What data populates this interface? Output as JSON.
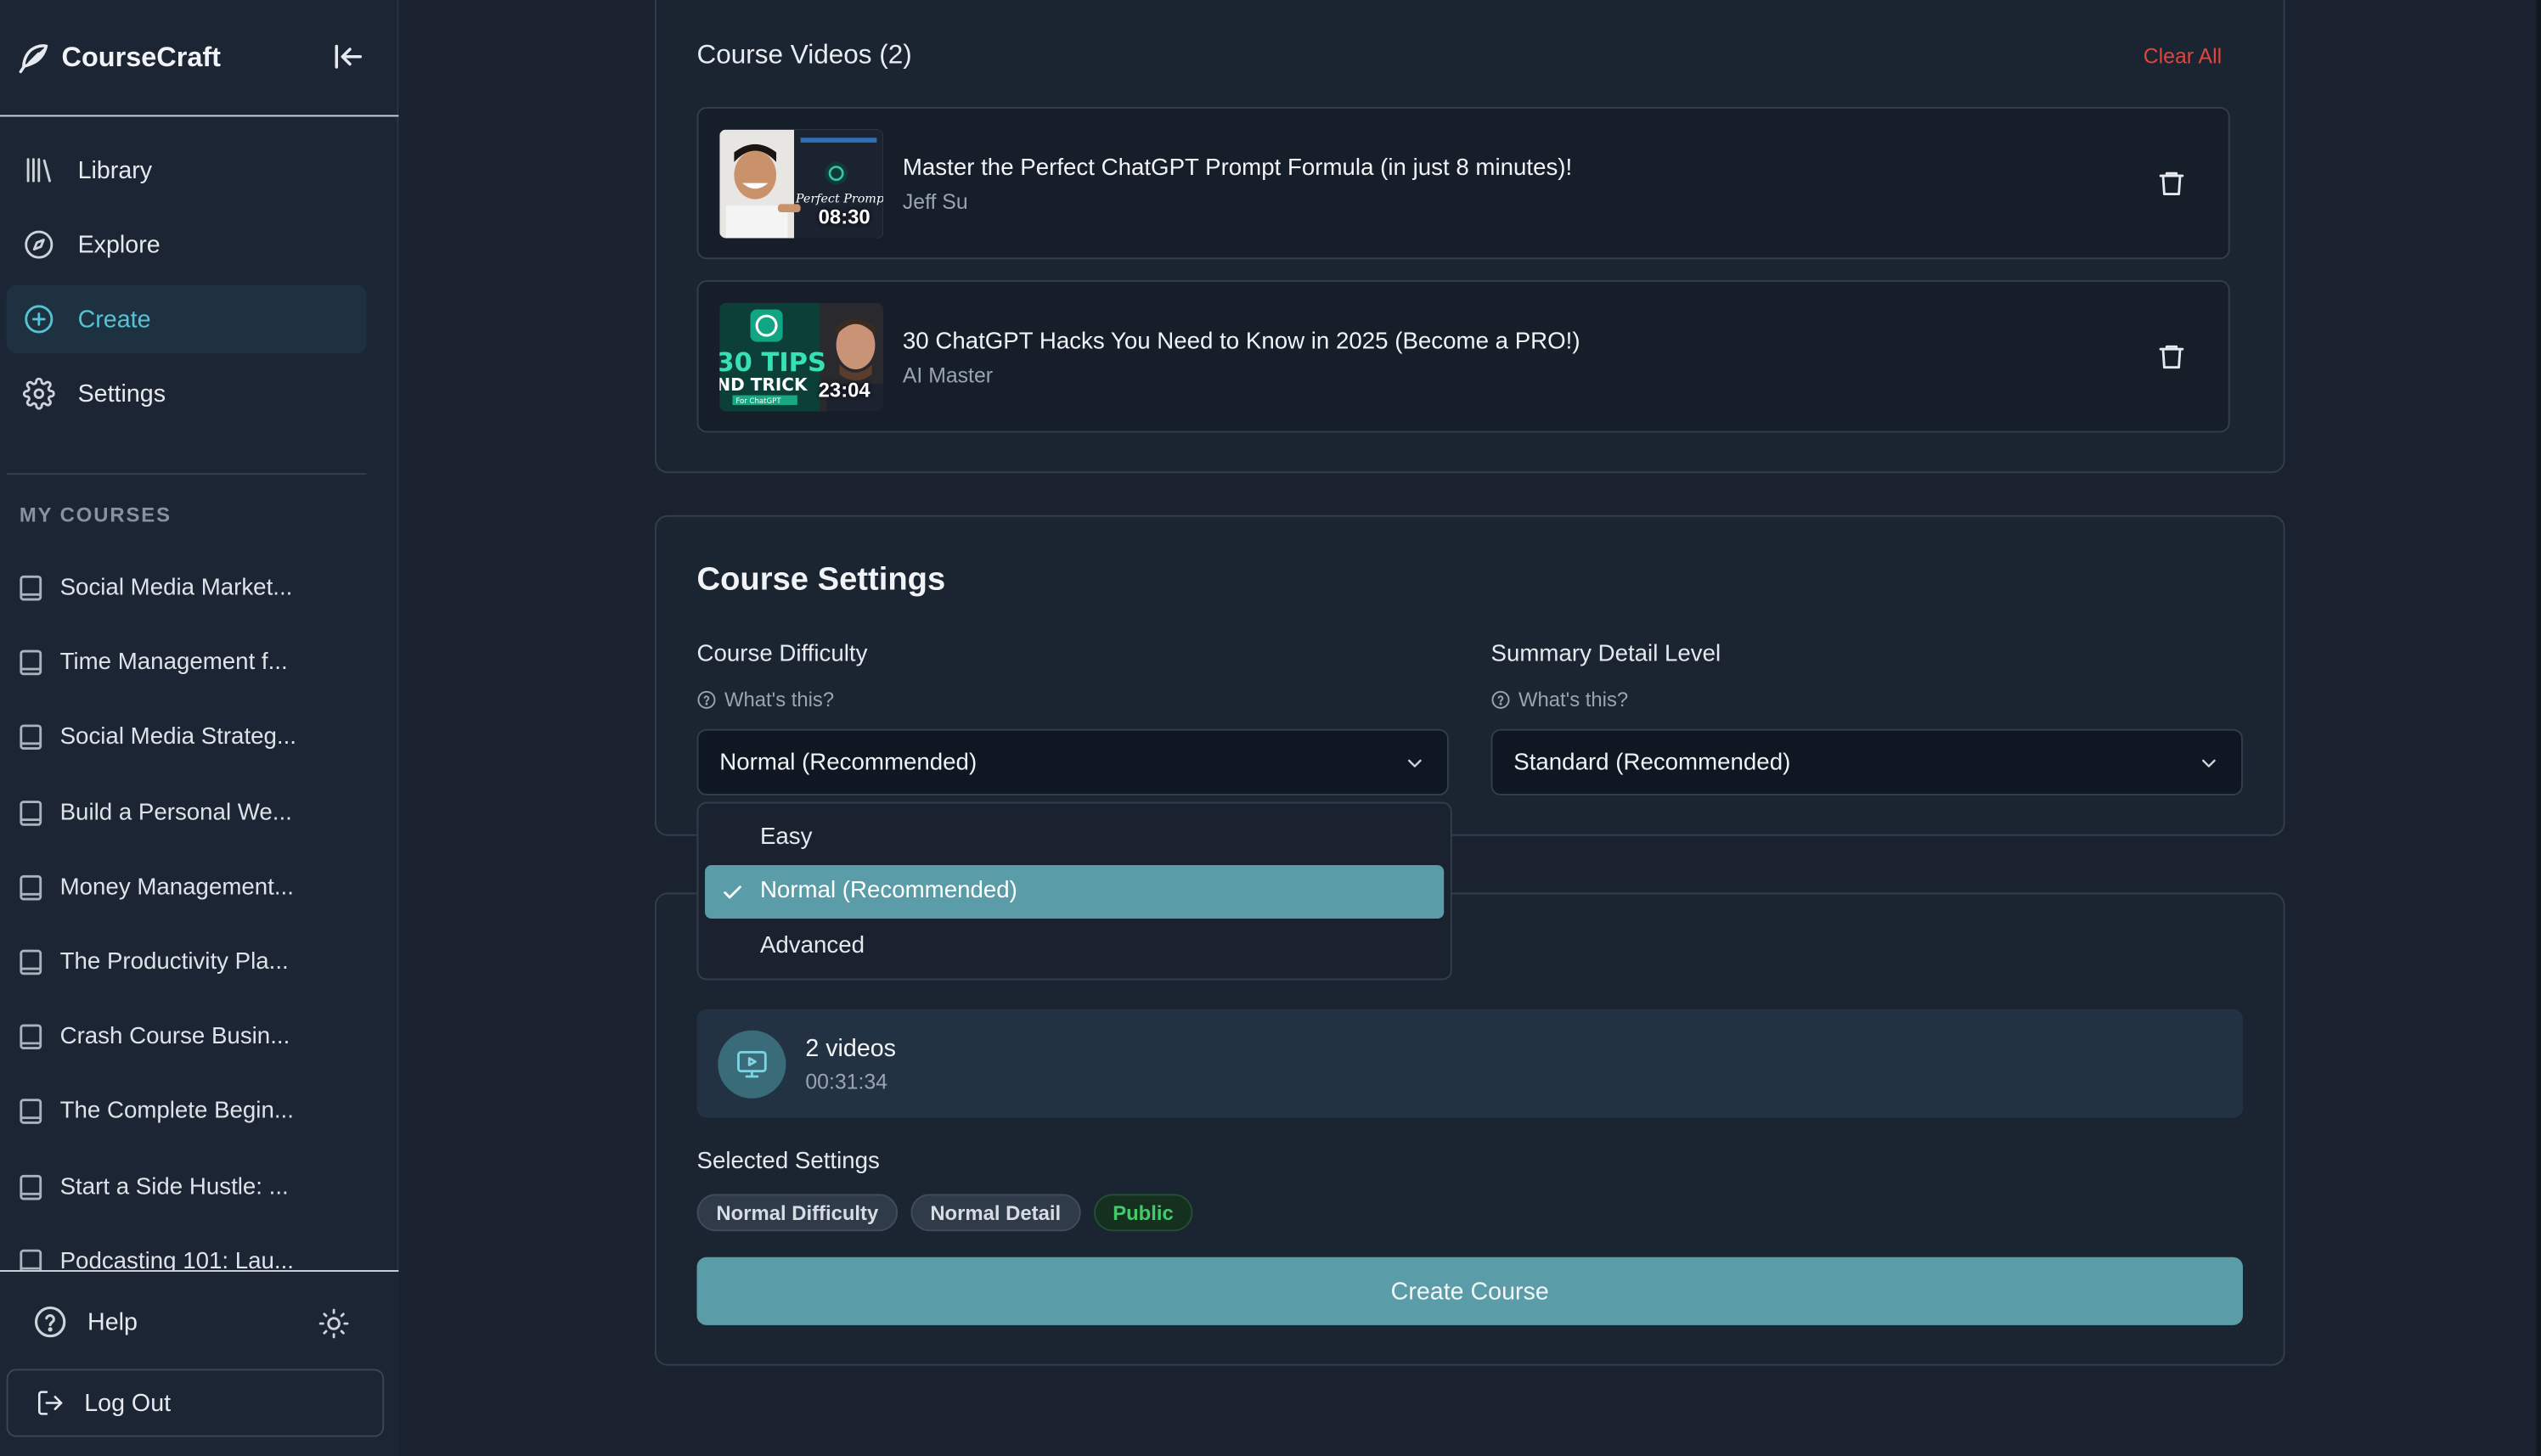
{
  "app": {
    "name": "CourseCraft"
  },
  "colors": {
    "accent": "#56c2d6",
    "primary_button": "#5a9ca8",
    "danger": "#e0453f",
    "public_badge": "#46c96d"
  },
  "sidebar": {
    "nav": [
      {
        "label": "Library",
        "icon": "library-icon"
      },
      {
        "label": "Explore",
        "icon": "compass-icon"
      },
      {
        "label": "Create",
        "icon": "plus-circle-icon",
        "active": true
      },
      {
        "label": "Settings",
        "icon": "gear-icon"
      }
    ],
    "section_title": "MY COURSES",
    "courses": [
      "Social Media Market...",
      "Time Management f...",
      "Social Media Strateg...",
      "Build a Personal We...",
      "Money Management...",
      "The Productivity Pla...",
      "Crash Course Busin...",
      "The Complete Begin...",
      "Start a Side Hustle: ...",
      "Podcasting 101: Lau..."
    ],
    "help_label": "Help",
    "logout_label": "Log Out"
  },
  "videos": {
    "title": "Course Videos (2)",
    "clear_all": "Clear All",
    "items": [
      {
        "title": "Master the Perfect ChatGPT Prompt Formula (in just 8 minutes)!",
        "author": "Jeff Su",
        "duration": "08:30",
        "thumb_text": "Perfect Prompt"
      },
      {
        "title": "30 ChatGPT Hacks You Need to Know in 2025 (Become a PRO!)",
        "author": "AI Master",
        "duration": "23:04",
        "thumb_text_1": "30 TIPS",
        "thumb_text_2": "ND TRICK",
        "thumb_text_3": "For ChatGPT"
      }
    ]
  },
  "settings": {
    "title": "Course Settings",
    "difficulty": {
      "label": "Course Difficulty",
      "help": "What's this?",
      "value": "Normal (Recommended)"
    },
    "detail": {
      "label": "Summary Detail Level",
      "help": "What's this?",
      "value": "Standard (Recommended)"
    },
    "difficulty_options": [
      "Easy",
      "Normal (Recommended)",
      "Advanced"
    ],
    "difficulty_selected_index": 1
  },
  "summary": {
    "video_count": "2 videos",
    "total_duration": "00:31:34",
    "selected_title": "Selected Settings",
    "badges": [
      "Normal Difficulty",
      "Normal Detail",
      "Public"
    ],
    "create_label": "Create Course"
  }
}
